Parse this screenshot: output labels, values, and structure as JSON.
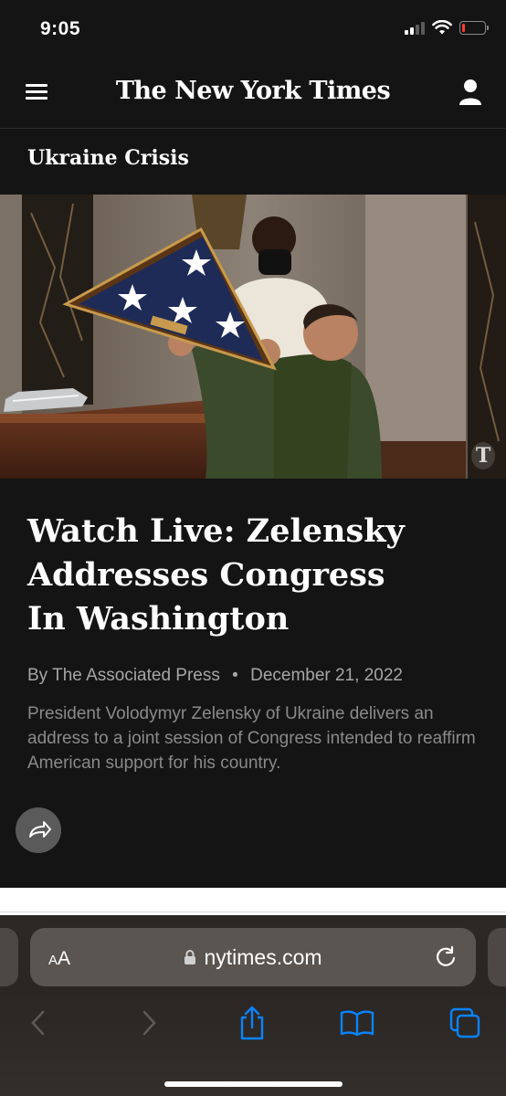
{
  "status_bar": {
    "time": "9:05"
  },
  "header": {
    "logo": "The New York Times",
    "menu_icon": "hamburger-menu-icon",
    "account_icon": "person-icon"
  },
  "section": {
    "label": "Ukraine Crisis"
  },
  "article": {
    "headline_lines": [
      "Watch Live: Zelensky",
      "Addresses Congress",
      "In Washington"
    ],
    "author": "By The Associated Press",
    "separator": "•",
    "date": "December 21, 2022",
    "summary": "President Volodymyr Zelensky of Ukraine delivers an address to a joint session of Congress intended to reaffirm American support for his country."
  },
  "browser": {
    "aa_label_small": "A",
    "aa_label_large": "A",
    "url": "nytimes.com",
    "toolbar": [
      "back-icon",
      "forward-icon",
      "share-icon",
      "bookmarks-icon",
      "tabs-icon"
    ]
  },
  "colors": {
    "background": "#141414",
    "accent_blue": "#0a84ff",
    "battery_low": "#ff3b30"
  }
}
